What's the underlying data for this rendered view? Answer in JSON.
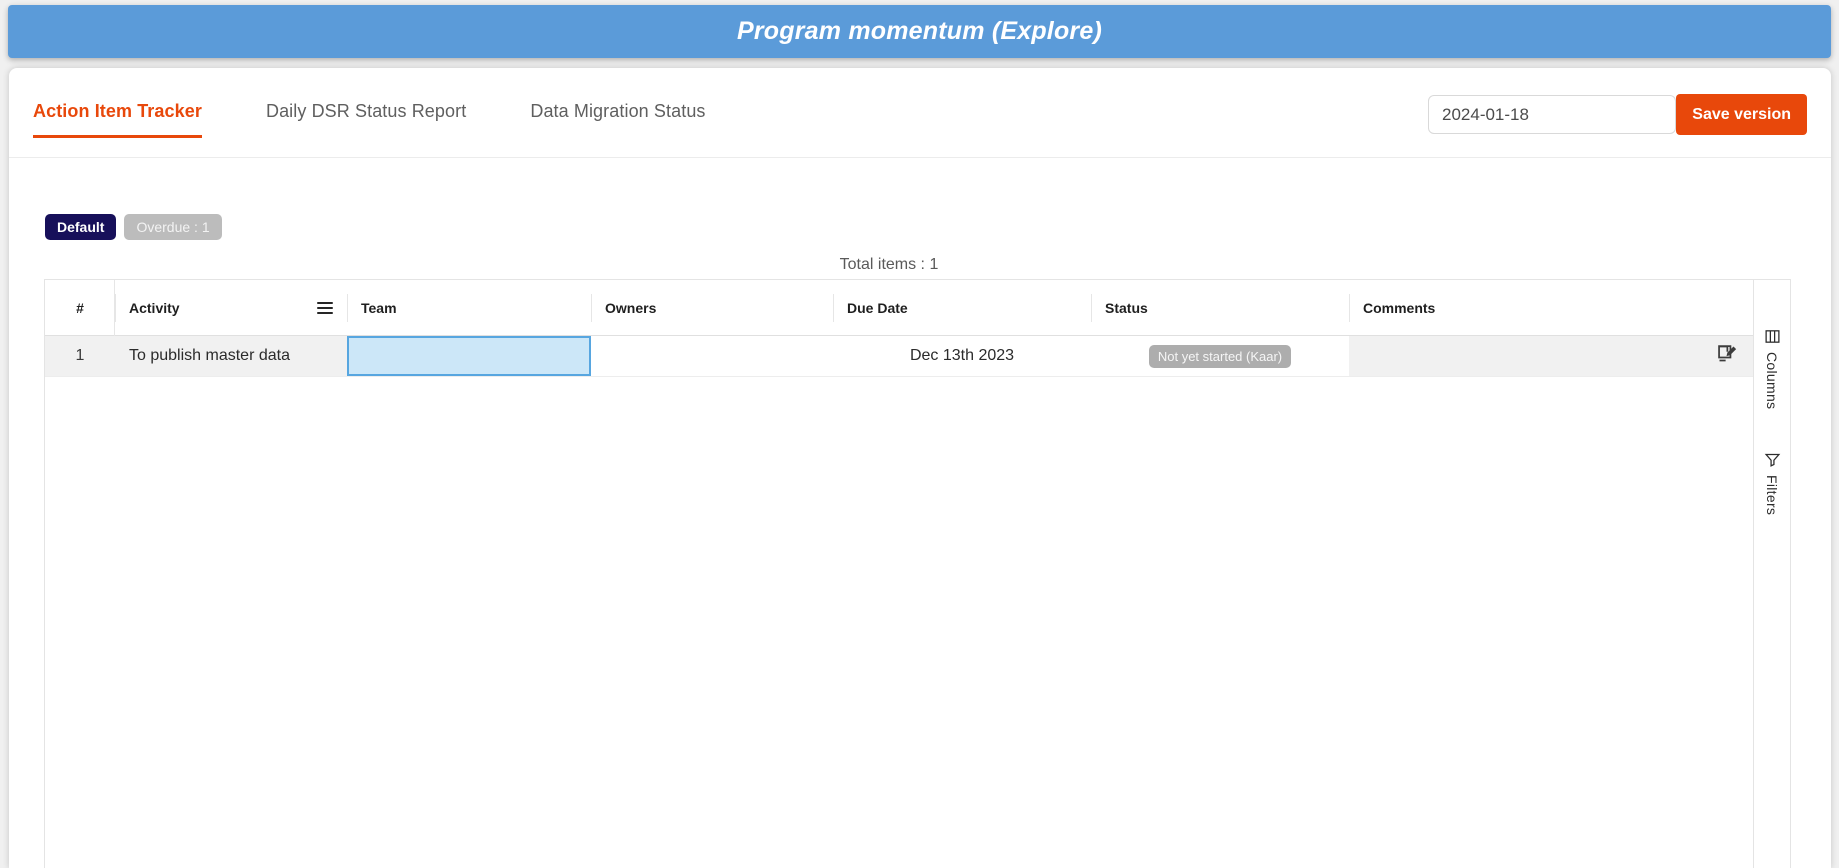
{
  "window": {
    "title": "Program momentum (Explore)",
    "header_color": "#5b9bd9"
  },
  "toolbar": {
    "tabs": [
      {
        "label": "Action Item Tracker",
        "active": true
      },
      {
        "label": "Daily DSR Status Report",
        "active": false
      },
      {
        "label": "Data Migration Status",
        "active": false
      }
    ],
    "date_picker": {
      "value": "2024-01-18",
      "placeholder": "Select date",
      "icon": "calendar-icon"
    },
    "save_label": "Save version",
    "accent_color": "#e8480b"
  },
  "filters": {
    "chips": [
      {
        "label": "Default",
        "style": "primary"
      },
      {
        "label": "Overdue : 1",
        "style": "muted"
      }
    ]
  },
  "summary": {
    "total_items": "Total items : 1"
  },
  "table": {
    "columns": [
      "#",
      "Activity",
      "Team",
      "Owners",
      "Due Date",
      "Status",
      "Comments"
    ],
    "rows": [
      {
        "index": "1",
        "activity": "To publish master data",
        "team": "",
        "owners": "",
        "due_date": "Dec 13th 2023",
        "status": "Not yet started (Kaar)",
        "comments": ""
      }
    ],
    "selected_cell": "team",
    "selection_color": "#cce7f8",
    "status_pill_color": "#adadad"
  },
  "side_rail": {
    "items": [
      {
        "label": "Columns",
        "icon": "columns-icon"
      },
      {
        "label": "Filters",
        "icon": "filter-icon"
      }
    ]
  }
}
